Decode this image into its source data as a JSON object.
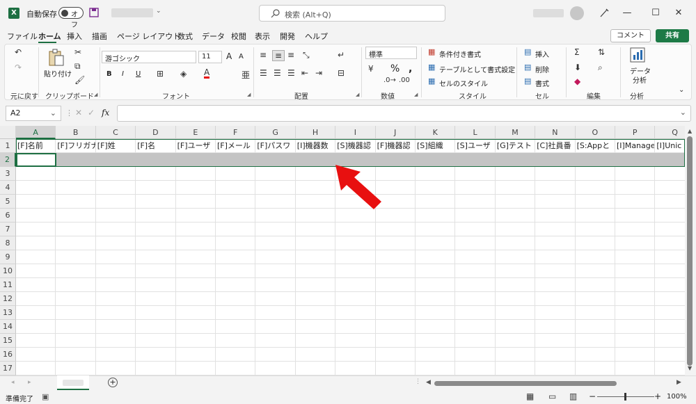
{
  "titlebar": {
    "app_icon": "X",
    "autosave_label": "自動保存",
    "autosave_state": "オフ",
    "search_placeholder": "検索 (Alt+Q)",
    "window_buttons": [
      "—",
      "☐",
      "✕"
    ]
  },
  "ribbon_tabs": [
    "ファイル",
    "ホーム",
    "挿入",
    "描画",
    "ページ レイアウト",
    "数式",
    "データ",
    "校閲",
    "表示",
    "開発",
    "ヘルプ"
  ],
  "active_tab": "ホーム",
  "actions": {
    "comment": "コメント",
    "share": "共有"
  },
  "ribbon": {
    "undo_group": "元に戻す",
    "clipboard": {
      "paste": "貼り付け",
      "label": "クリップボード"
    },
    "font": {
      "name": "游ゴシック",
      "size": "11",
      "label": "フォント",
      "bold": "B",
      "italic": "I",
      "underline": "U",
      "grow": "A",
      "shrink": "A"
    },
    "alignment": {
      "label": "配置"
    },
    "number": {
      "format": "標準",
      "label": "数値",
      "percent": "%"
    },
    "styles": {
      "conditional": "条件付き書式",
      "table": "テーブルとして書式設定",
      "cell_style": "セルのスタイル",
      "label": "スタイル"
    },
    "cells": {
      "insert": "挿入",
      "delete": "削除",
      "format": "書式",
      "label": "セル"
    },
    "edit": {
      "label": "編集"
    },
    "analysis": {
      "button_line1": "データ",
      "button_line2": "分析",
      "label": "分析"
    }
  },
  "formula_bar": {
    "name_box": "A2",
    "fx": "fx",
    "value": ""
  },
  "sheet": {
    "columns": [
      "A",
      "B",
      "C",
      "D",
      "E",
      "F",
      "G",
      "H",
      "I",
      "J",
      "K",
      "L",
      "M",
      "N",
      "O",
      "P",
      "Q"
    ],
    "rows": [
      "1",
      "2",
      "3",
      "4",
      "5",
      "6",
      "7",
      "8",
      "9",
      "10",
      "11",
      "12",
      "13",
      "14",
      "15",
      "16",
      "17"
    ],
    "row1": [
      "[F]名前",
      "[F]フリガナ",
      "[F]姓",
      "[F]名",
      "[F]ユーザ",
      "[F]メール",
      "[F]パスワ",
      "[I]機器数",
      "[S]機器認",
      "[F]機器認",
      "[S]組織",
      "[S]ユーザ",
      "[G]テスト",
      "[C]社員番",
      "[S:Appと",
      "[I]Manage",
      "[I]Unic"
    ],
    "selected_cell": "A2"
  },
  "statusbar": {
    "ready": "準備完了",
    "zoom": "100%"
  },
  "colors": {
    "excel_green": "#1d6f42",
    "arrow_red": "#e81010",
    "row2_fill": "#c4c4c4"
  }
}
